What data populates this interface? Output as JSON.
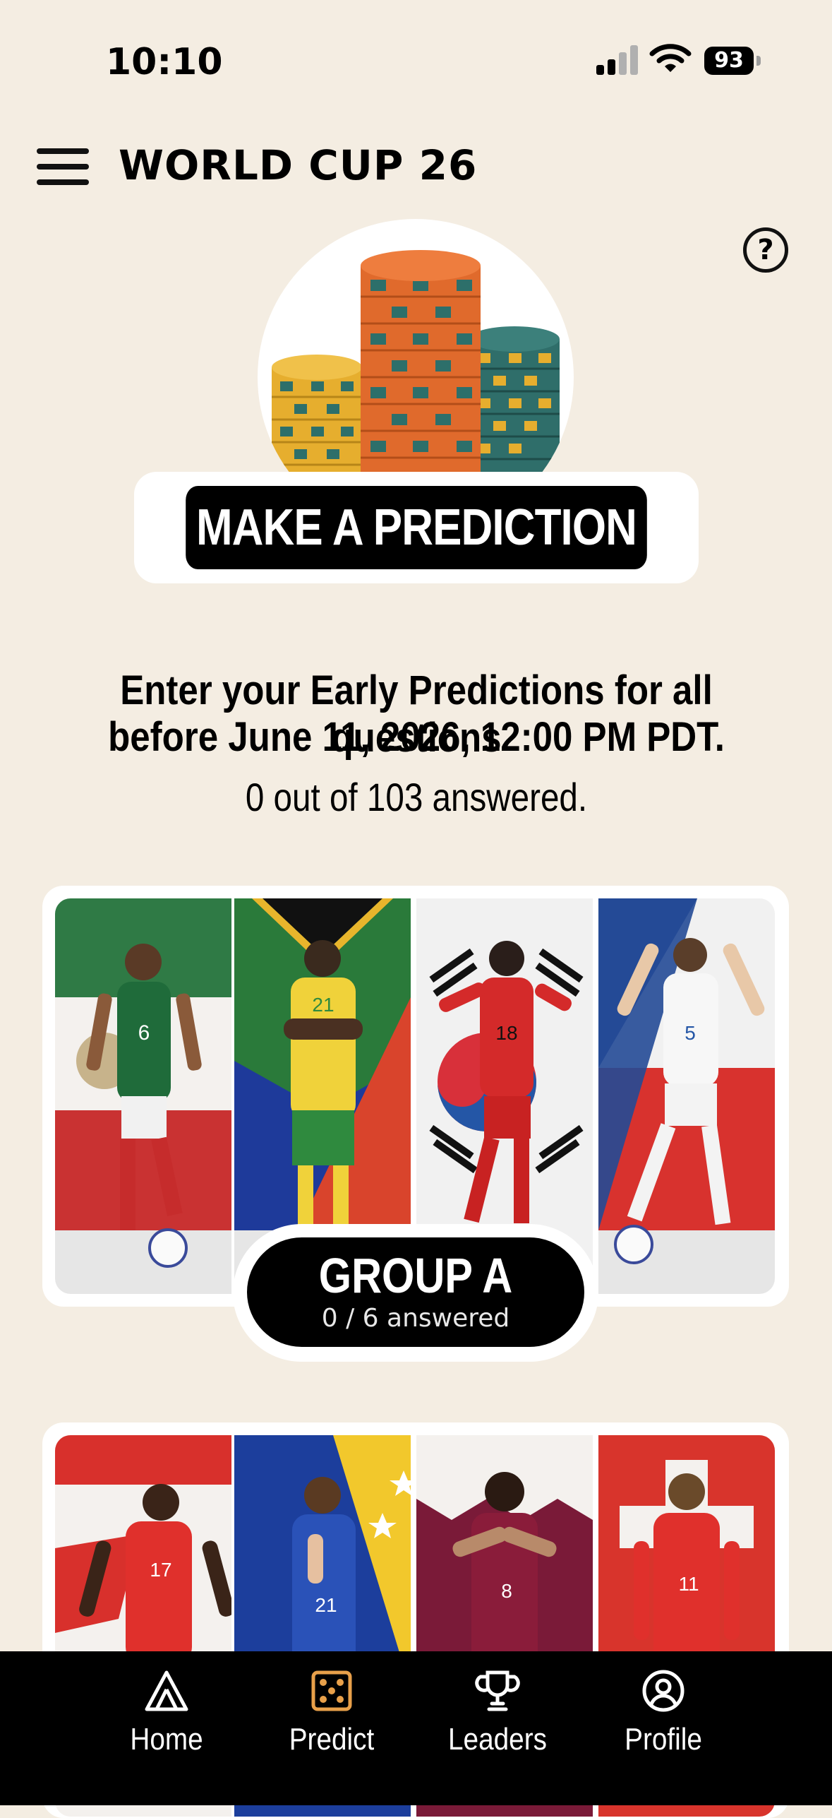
{
  "status_bar": {
    "time": "10:10",
    "battery": "93"
  },
  "header": {
    "title": "WORLD CUP 26"
  },
  "hero": {
    "cta_label": "MAKE A PREDICTION"
  },
  "info": {
    "line1": "Enter your Early Predictions for all questions",
    "line2": "before June 11, 2026, 12:00 PM PDT.",
    "progress": "0 out of 103 answered."
  },
  "groups": [
    {
      "name": "GROUP A",
      "progress": "0 / 6 answered",
      "teams": [
        {
          "jersey_number": "6"
        },
        {
          "jersey_number": "21"
        },
        {
          "jersey_number": "18"
        },
        {
          "jersey_number": "5"
        }
      ]
    },
    {
      "teams": [
        {
          "jersey_number": "17"
        },
        {
          "jersey_number": "21"
        },
        {
          "jersey_number": "8"
        },
        {
          "jersey_number": "11"
        }
      ]
    }
  ],
  "bottom_nav": {
    "items": [
      {
        "label": "Home",
        "icon": "home-icon"
      },
      {
        "label": "Predict",
        "icon": "dice-icon",
        "active": true
      },
      {
        "label": "Leaders",
        "icon": "trophy-icon"
      },
      {
        "label": "Profile",
        "icon": "profile-icon"
      }
    ],
    "active_color": "#e8a04a"
  }
}
